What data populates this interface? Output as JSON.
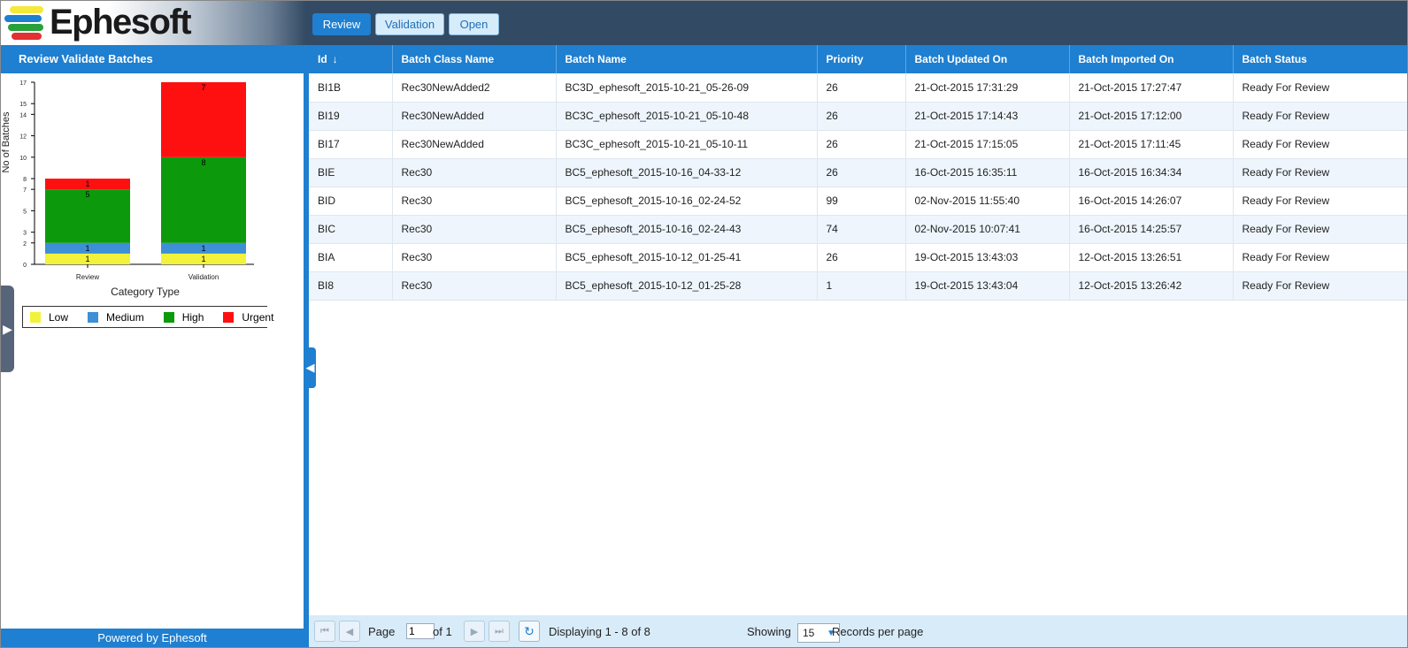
{
  "app": {
    "logo_text": "Ephesoft"
  },
  "tabs": [
    {
      "label": "Review"
    },
    {
      "label": "Validation"
    },
    {
      "label": "Open"
    }
  ],
  "left_panel": {
    "title": "Review Validate Batches",
    "footer": "Powered by Ephesoft"
  },
  "chart_data": {
    "type": "bar",
    "stacked": true,
    "categories": [
      "Review",
      "Validation"
    ],
    "series": [
      {
        "name": "Low",
        "color": "#f2f23a",
        "values": [
          1,
          1
        ]
      },
      {
        "name": "Medium",
        "color": "#3d8fd6",
        "values": [
          1,
          1
        ]
      },
      {
        "name": "High",
        "color": "#0c9a0c",
        "values": [
          5,
          8
        ]
      },
      {
        "name": "Urgent",
        "color": "#ff1010",
        "values": [
          1,
          7
        ]
      }
    ],
    "xlabel": "Category Type",
    "ylabel": "No of Batches",
    "yticks": [
      0,
      2,
      3,
      5,
      7,
      8,
      10,
      12,
      14,
      15,
      17
    ],
    "ylim": [
      0,
      17
    ],
    "legend_position": "bottom"
  },
  "grid": {
    "columns": [
      "Id",
      "Batch Class Name",
      "Batch Name",
      "Priority",
      "Batch Updated On",
      "Batch Imported On",
      "Batch Status"
    ],
    "sort_arrow": "↓",
    "rows": [
      [
        "BI1B",
        "Rec30NewAdded2",
        "BC3D_ephesoft_2015-10-21_05-26-09",
        "26",
        "21-Oct-2015 17:31:29",
        "21-Oct-2015 17:27:47",
        "Ready For Review"
      ],
      [
        "BI19",
        "Rec30NewAdded",
        "BC3C_ephesoft_2015-10-21_05-10-48",
        "26",
        "21-Oct-2015 17:14:43",
        "21-Oct-2015 17:12:00",
        "Ready For Review"
      ],
      [
        "BI17",
        "Rec30NewAdded",
        "BC3C_ephesoft_2015-10-21_05-10-11",
        "26",
        "21-Oct-2015 17:15:05",
        "21-Oct-2015 17:11:45",
        "Ready For Review"
      ],
      [
        "BIE",
        "Rec30",
        "BC5_ephesoft_2015-10-16_04-33-12",
        "26",
        "16-Oct-2015 16:35:11",
        "16-Oct-2015 16:34:34",
        "Ready For Review"
      ],
      [
        "BID",
        "Rec30",
        "BC5_ephesoft_2015-10-16_02-24-52",
        "99",
        "02-Nov-2015 11:55:40",
        "16-Oct-2015 14:26:07",
        "Ready For Review"
      ],
      [
        "BIC",
        "Rec30",
        "BC5_ephesoft_2015-10-16_02-24-43",
        "74",
        "02-Nov-2015 10:07:41",
        "16-Oct-2015 14:25:57",
        "Ready For Review"
      ],
      [
        "BIA",
        "Rec30",
        "BC5_ephesoft_2015-10-12_01-25-41",
        "26",
        "19-Oct-2015 13:43:03",
        "12-Oct-2015 13:26:51",
        "Ready For Review"
      ],
      [
        "BI8",
        "Rec30",
        "BC5_ephesoft_2015-10-12_01-25-28",
        "1",
        "19-Oct-2015 13:43:04",
        "12-Oct-2015 13:26:42",
        "Ready For Review"
      ]
    ]
  },
  "pager": {
    "page_label": "Page",
    "page_value": "1",
    "of_label": "of 1",
    "displaying": "Displaying 1 - 8 of 8",
    "showing_label": "Showing",
    "records_per_page": "15",
    "records_label": "Records per page"
  },
  "icons": {
    "first": "first-page-icon",
    "prev": "prev-page-icon",
    "next": "next-page-icon",
    "last": "last-page-icon",
    "refresh": "refresh-icon"
  }
}
